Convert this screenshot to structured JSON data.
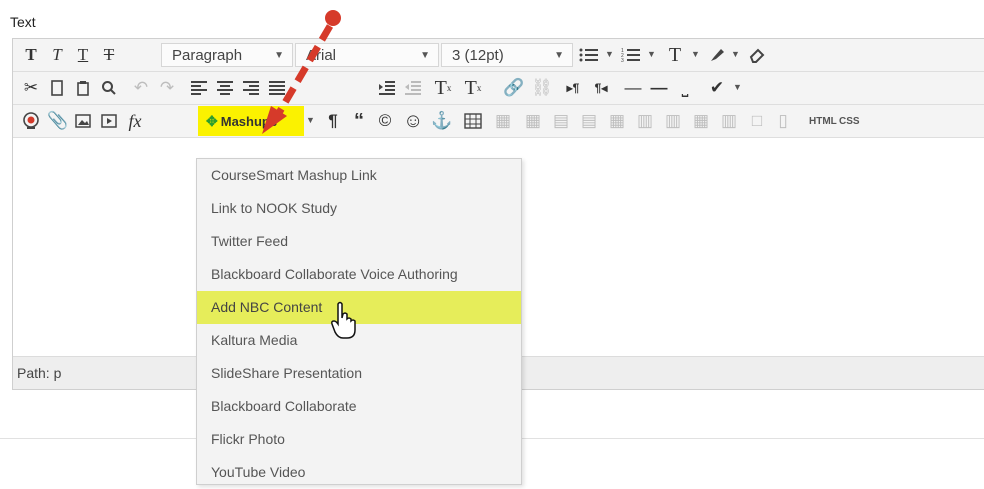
{
  "field_label": "Text",
  "toolbar1": {
    "bold": "T",
    "italic": "T",
    "underline": "T",
    "strike": "T",
    "format_select": "Paragraph",
    "font_select": "Arial",
    "size_select": "3 (12pt)"
  },
  "toolbar2": {
    "sup": "T",
    "sub": "T"
  },
  "toolbar3": {
    "fx": "fx",
    "mashups_label": "Mashups",
    "pilcrow": "¶",
    "quote": "“",
    "html": "HTML",
    "css": "CSS"
  },
  "path": "Path: p",
  "mashups_menu": {
    "items": [
      {
        "label": "CourseSmart Mashup Link"
      },
      {
        "label": "Link to NOOK Study"
      },
      {
        "label": "Twitter Feed"
      },
      {
        "label": "Blackboard Collaborate Voice Authoring"
      },
      {
        "label": "Add NBC Content"
      },
      {
        "label": "Kaltura Media"
      },
      {
        "label": "SlideShare Presentation"
      },
      {
        "label": "Blackboard Collaborate"
      },
      {
        "label": "Flickr Photo"
      },
      {
        "label": "YouTube Video"
      }
    ],
    "highlighted_index": 4
  },
  "colors": {
    "mashups_highlight": "#fbf200",
    "menu_highlight": "#e6ed5a",
    "arrow": "#d63a2a"
  }
}
